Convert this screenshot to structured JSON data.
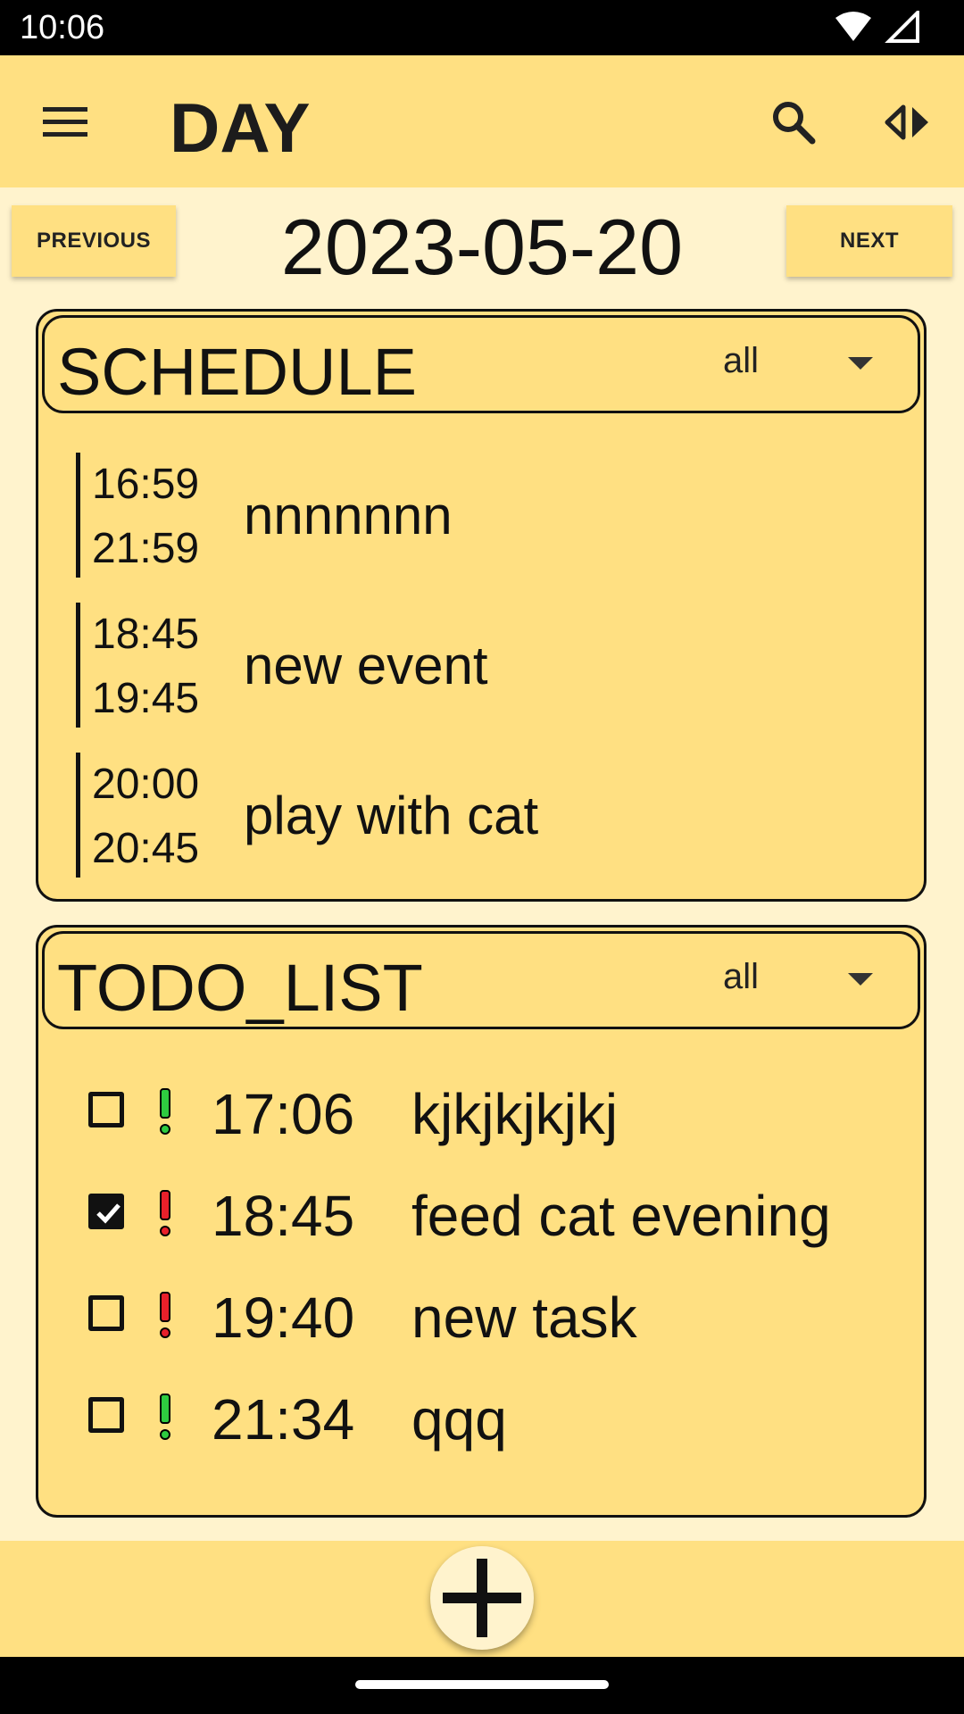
{
  "status_bar": {
    "time": "10:06"
  },
  "app_bar": {
    "title": "DAY"
  },
  "date_nav": {
    "previous_label": "PREVIOUS",
    "date": "2023-05-20",
    "next_label": "NEXT"
  },
  "schedule": {
    "title": "SCHEDULE",
    "filter": "all",
    "events": [
      {
        "start": "16:59",
        "end": "21:59",
        "title": "nnnnnnn"
      },
      {
        "start": "18:45",
        "end": "19:45",
        "title": "new event"
      },
      {
        "start": "20:00",
        "end": "20:45",
        "title": "play with cat"
      }
    ]
  },
  "todo_list": {
    "title": "TODO_LIST",
    "filter": "all",
    "items": [
      {
        "checked": false,
        "priority": "low",
        "priority_color": "#2ecc40",
        "time": "17:06",
        "title": "kjkjkjkjkj"
      },
      {
        "checked": true,
        "priority": "high",
        "priority_color": "#e8202a",
        "time": "18:45",
        "title": "feed cat evening"
      },
      {
        "checked": false,
        "priority": "high",
        "priority_color": "#e8202a",
        "time": "19:40",
        "title": "new task"
      },
      {
        "checked": false,
        "priority": "low",
        "priority_color": "#2ecc40",
        "time": "21:34",
        "title": "qqq"
      }
    ]
  },
  "fab": {
    "icon": "plus-icon"
  },
  "colors": {
    "surface": "#ffe082",
    "background": "#fff3cd"
  }
}
